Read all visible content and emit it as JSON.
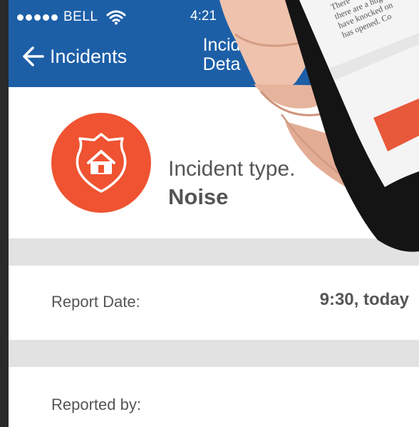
{
  "status_bar": {
    "carrier": "BELL",
    "time": "4:21"
  },
  "nav": {
    "back_label": "Incidents",
    "title_line1": "Incid",
    "title_line2": "Deta"
  },
  "incident": {
    "type_label": "Incident type.",
    "type_value": "Noise",
    "icon": "police-house-shield-icon"
  },
  "rows": [
    {
      "label": "Report Date:",
      "value": "9:30, today"
    },
    {
      "label": "Reported by:",
      "value": ""
    }
  ],
  "second_phone_text": [
    "There",
    "there are a huge",
    "have knocked on",
    "has opened. Co"
  ],
  "colors": {
    "nav": "#1d5fa7",
    "accent": "#ef5331",
    "separator": "#e2e2e2"
  }
}
